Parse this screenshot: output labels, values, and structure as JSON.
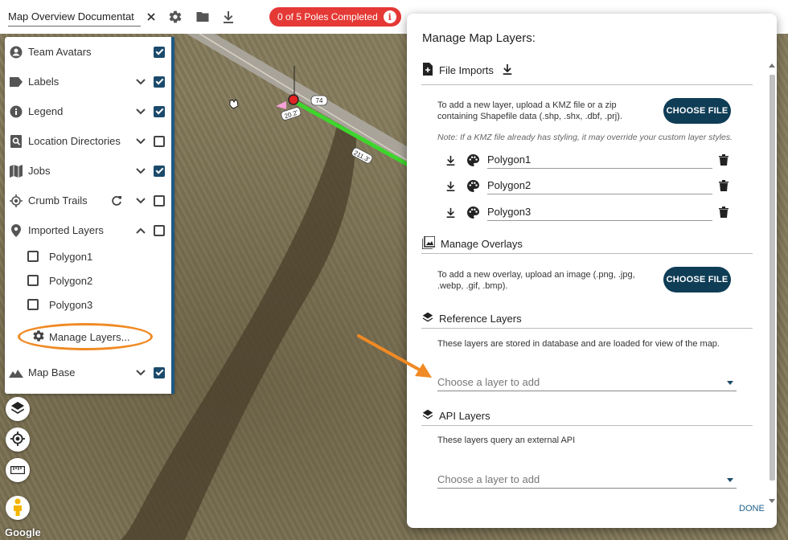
{
  "toolbar": {
    "document_title": "Map Overview Documentat",
    "poles_badge": "0 of 5 Poles Completed",
    "poles_badge_info": "i"
  },
  "map": {
    "google_logo": "Google",
    "road_labels": [
      "74",
      "20.2'",
      "211.3'"
    ]
  },
  "layer_panel": {
    "items": [
      {
        "label": "Team Avatars",
        "icon": "avatar-icon",
        "expand": "none",
        "checked": true
      },
      {
        "label": "Labels",
        "icon": "label-tag-icon",
        "expand": "down",
        "checked": true
      },
      {
        "label": "Legend",
        "icon": "info-icon",
        "expand": "down",
        "checked": true
      },
      {
        "label": "Location Directories",
        "icon": "location-search-icon",
        "expand": "down",
        "checked": false
      },
      {
        "label": "Jobs",
        "icon": "map-icon",
        "expand": "down",
        "checked": true
      },
      {
        "label": "Crumb Trails",
        "icon": "crosshair-icon",
        "expand": "down",
        "checked": false
      },
      {
        "label": "Imported Layers",
        "icon": "pin-icon",
        "expand": "up",
        "checked": false
      }
    ],
    "imported_sublayers": [
      {
        "label": "Polygon1",
        "checked": false
      },
      {
        "label": "Polygon2",
        "checked": false
      },
      {
        "label": "Polygon3",
        "checked": false
      }
    ],
    "manage_layers_label": "Manage Layers...",
    "map_base": {
      "label": "Map Base",
      "checked": true
    }
  },
  "modal": {
    "title": "Manage Map Layers:",
    "file_imports": {
      "heading": "File Imports",
      "description_line1": "To add a new layer, upload a KMZ file or a zip",
      "description_line2": "containing Shapefile data (.shp, .shx, .dbf, .prj).",
      "choose_label": "CHOOSE FILE",
      "note": "Note: If a KMZ file already has styling, it may override your custom layer styles.",
      "files": [
        "Polygon1",
        "Polygon2",
        "Polygon3"
      ]
    },
    "overlays": {
      "heading": "Manage Overlays",
      "description_line1": "To add a new overlay, upload an image (.png, .jpg,",
      "description_line2": ".webp, .gif, .bmp).",
      "choose_label": "CHOOSE FILE"
    },
    "reference_layers": {
      "heading": "Reference Layers",
      "description": "These layers are stored in database and are loaded for view of the map.",
      "placeholder": "Choose a layer to add"
    },
    "api_layers": {
      "heading": "API Layers",
      "description": "These layers query an external API",
      "placeholder": "Choose a layer to add"
    },
    "done_label": "DONE"
  },
  "colors": {
    "accent": "#0f3d56",
    "badge": "#e53935",
    "highlight": "#f08a24",
    "route": "#3dd62c"
  }
}
